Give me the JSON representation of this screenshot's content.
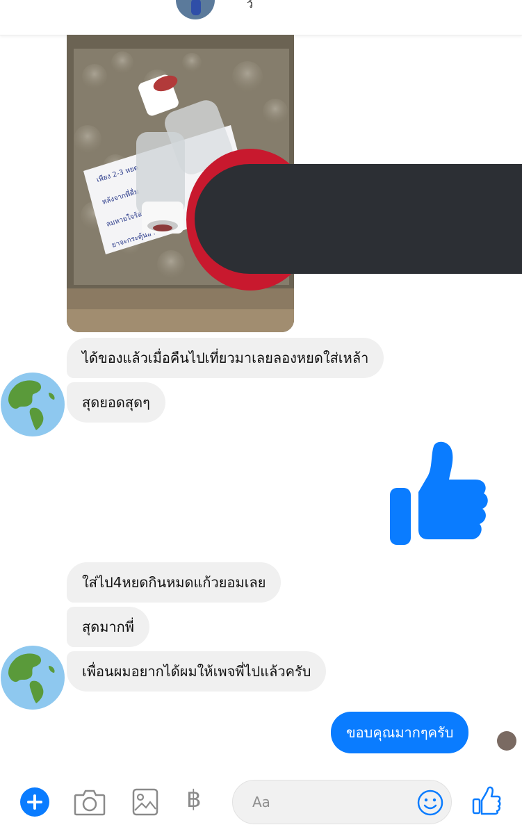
{
  "header": {
    "name": "ว์"
  },
  "messages": [
    {
      "text": "ได้ของแล้วเมื่อคืนไปเที่ยวมาเลยลองหยดใส่เหล้า"
    },
    {
      "text": "สุดยอดสุดๆ"
    },
    {
      "text": "ใส่ไป4หยดกินหมดแก้วยอมเลย"
    },
    {
      "text": "สุดมากพี่"
    },
    {
      "text": "เพื่อนผมอยากได้ผมให้เพจพี่ไปแล้วครับ"
    },
    {
      "text": "ขอบคุณมากๆครับ"
    }
  ],
  "photo_card": {
    "lines": [
      "เพียง 2-3 หยด",
      "หลังจากที่ดื่ม",
      "ลมหายใจร้อ",
      "ยาจะกระตุ้นอา"
    ]
  },
  "composer": {
    "placeholder": "Aa",
    "currency_symbol": "฿",
    "accent_color": "#0a7cff"
  },
  "colors": {
    "incoming_bubble": "#f0f0f0",
    "outgoing_bubble": "#0a7cff",
    "redact_bar": "#2c2f34",
    "redact_ring": "#c8192e"
  },
  "icons": {
    "add": "plus-icon",
    "camera": "camera-icon",
    "gallery": "image-icon",
    "payment": "baht-icon",
    "emoji": "smiley-icon",
    "like": "thumbs-up-icon",
    "avatar": "globe-icon"
  }
}
